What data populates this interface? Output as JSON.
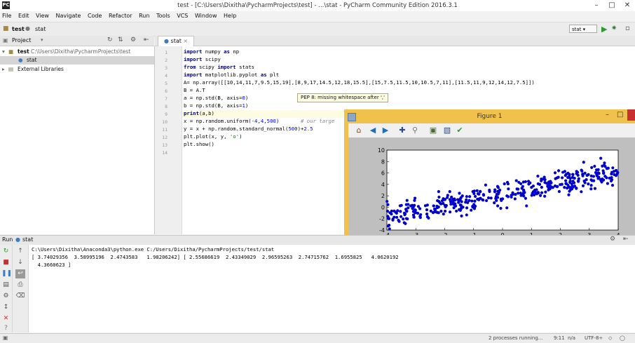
{
  "window": {
    "title": "test - [C:\\Users\\Dixitha\\PycharmProjects\\test] - ...\\stat - PyCharm Community Edition 2016.3.1"
  },
  "menu": [
    "File",
    "Edit",
    "View",
    "Navigate",
    "Code",
    "Refactor",
    "Run",
    "Tools",
    "VCS",
    "Window",
    "Help"
  ],
  "breadcrumb": [
    "test",
    "stat"
  ],
  "run_config": "stat",
  "project": {
    "header": "Project",
    "root_name": "test",
    "root_path": "C:\\Users\\Dixitha\\PycharmProjects\\test",
    "file": "stat",
    "external": "External Libraries"
  },
  "editor": {
    "tab": "stat",
    "lines": [
      "1",
      "2",
      "3",
      "4",
      "5",
      "6",
      "7",
      "8",
      "9",
      "10",
      "11",
      "12",
      "13",
      "14"
    ],
    "tooltip": "PEP 8: missing whitespace after ','"
  },
  "figure": {
    "title": "Figure 1"
  },
  "chart_data": {
    "type": "scatter",
    "xlim": [
      -4,
      4
    ],
    "ylim": [
      -4,
      10
    ],
    "xticks": [
      "-4",
      "-3",
      "-2",
      "-1",
      "0",
      "1",
      "2",
      "3",
      "4"
    ],
    "yticks": [
      "10",
      "8",
      "6",
      "4",
      "2",
      "0",
      "-2",
      "-4"
    ],
    "color": "#0000cc"
  },
  "run": {
    "label": "Run",
    "tab": "stat",
    "console": [
      "C:\\Users\\Dixitha\\Anaconda3\\python.exe C:/Users/Dixitha/PycharmProjects/test/stat",
      "[ 3.74029356  3.58995196  2.4743583   1.98206242] [ 2.55686619  2.43349029  2.96595263  2.74715762  1.6955825   4.0620192",
      "  4.3660623 ]"
    ]
  },
  "status": {
    "processes": "2 processes running...",
    "position": "9:11",
    "lf": "n/a",
    "encoding": "UTF-8÷"
  }
}
